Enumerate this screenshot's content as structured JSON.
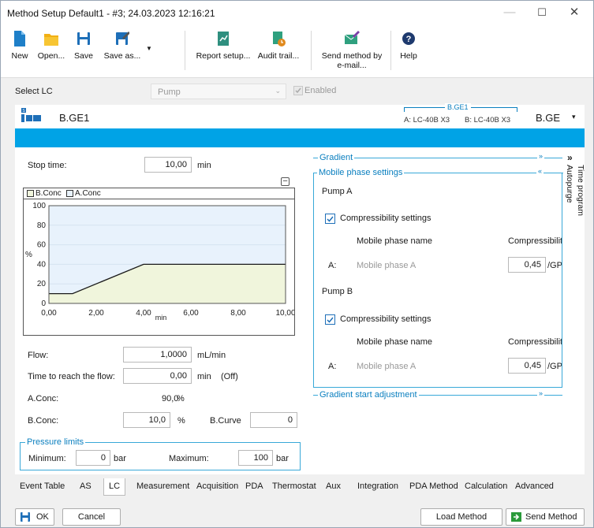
{
  "window": {
    "title": "Method Setup Default1 - #3;  24.03.2023  12:16:21"
  },
  "toolbar": {
    "new": "New",
    "open": "Open...",
    "save": "Save",
    "save_as": "Save as...",
    "report_setup": "Report setup...",
    "audit_trail": "Audit trail...",
    "send_method_1": "Send method by",
    "send_method_2": "e-mail...",
    "help": "Help"
  },
  "select_lc": {
    "label": "Select LC",
    "value": "Pump",
    "enabled_label": "Enabled"
  },
  "header": {
    "system_name": "B.GE1",
    "group_label": "B.GE1",
    "a_unit": "A: LC-40B X3",
    "b_unit": "B: LC-40B X3",
    "dropdown_value": "B.GE"
  },
  "stop_time": {
    "label": "Stop time:",
    "value": "10,00",
    "unit": "min"
  },
  "legend": {
    "b_conc": "B.Conc",
    "a_conc": "A.Conc"
  },
  "chart_data": {
    "type": "area",
    "title": "",
    "xlabel": "min",
    "ylabel": "%",
    "xlim": [
      0,
      10
    ],
    "ylim": [
      0,
      100
    ],
    "x_ticks": [
      "0,00",
      "2,00",
      "4,00",
      "6,00",
      "8,00",
      "10,00"
    ],
    "y_ticks": [
      "0",
      "20",
      "40",
      "60",
      "80",
      "100"
    ],
    "series": [
      {
        "name": "B.Conc",
        "x": [
          0,
          1,
          4,
          10
        ],
        "y": [
          10,
          10,
          40,
          40
        ]
      },
      {
        "name": "A.Conc",
        "x": [
          0,
          1,
          4,
          10
        ],
        "y": [
          90,
          90,
          60,
          60
        ]
      }
    ]
  },
  "flow": {
    "label": "Flow:",
    "value": "1,0000",
    "unit": "mL/min"
  },
  "time_to_flow": {
    "label": "Time to reach the flow:",
    "value": "0,00",
    "unit": "min",
    "state": "(Off)"
  },
  "a_conc": {
    "label": "A.Conc:",
    "value": "90,0",
    "unit": "%"
  },
  "b_conc": {
    "label": "B.Conc:",
    "value": "10,0",
    "unit": "%",
    "curve_label": "B.Curve",
    "curve_value": "0"
  },
  "pressure": {
    "title": "Pressure limits",
    "min_label": "Minimum:",
    "min_value": "0",
    "max_label": "Maximum:",
    "max_value": "100",
    "unit": "bar"
  },
  "gradient": {
    "label": "Gradient"
  },
  "mobile_phase": {
    "title": "Mobile phase settings",
    "pump_a": "Pump A",
    "pump_b": "Pump B",
    "compress_settings": "Compressibility settings",
    "name_header": "Mobile phase name",
    "compress_header": "Compressibilit",
    "row_a_label": "A:",
    "row_a_name": "Mobile phase A",
    "row_a_value": "0,45",
    "unit": "/GPa",
    "row_b_label": "A:",
    "row_b_name": "Mobile phase A",
    "row_b_value": "0,45"
  },
  "gradient_start": {
    "label": "Gradient start adjustment"
  },
  "side": {
    "time_program": "Time program",
    "autopurge": "Autopurge"
  },
  "tabs": [
    "Event Table",
    "AS",
    "LC",
    "Measurement",
    "Acquisition",
    "PDA",
    "Thermostat",
    "Aux",
    "Integration",
    "PDA Method",
    "Calculation",
    "Advanced"
  ],
  "footer": {
    "ok": "OK",
    "cancel": "Cancel",
    "load_method": "Load Method",
    "send_method": "Send Method"
  },
  "colors": {
    "accent": "#00a3e6",
    "b_fill": "#f0f5dc",
    "a_fill": "#e8f2fc"
  }
}
